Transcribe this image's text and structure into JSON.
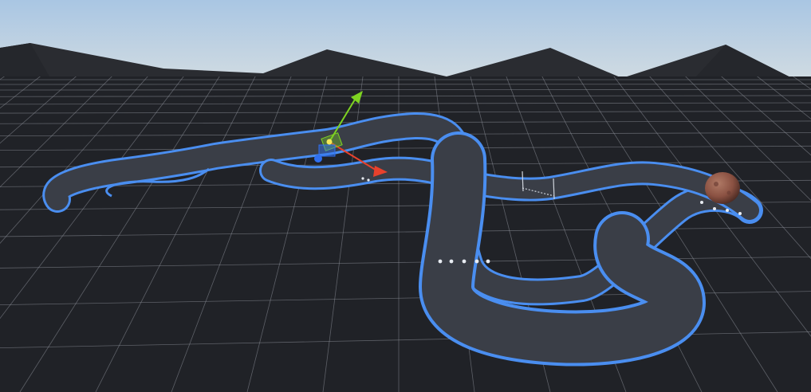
{
  "scene": {
    "view": "3d-scene-view",
    "colors": {
      "sky_top": "#a9c6e3",
      "sky_bottom": "#d4dde2",
      "mountain": "#2a2c31",
      "ground": "#202227",
      "grid_line": "#8f949c",
      "track_surface": "#3a3e47",
      "track_edge": "#4a8ef0",
      "gizmo_y": "#7ed321",
      "gizmo_x": "#e8412c",
      "gizmo_z": "#2f6ff0",
      "boulder": "#8a5142"
    },
    "objects": [
      {
        "name": "race-track",
        "kind": "track-spline"
      },
      {
        "name": "checkpoint-gate",
        "kind": "gate"
      },
      {
        "name": "boulder",
        "kind": "rock-sphere"
      },
      {
        "name": "transform-gizmo",
        "kind": "move-tool",
        "axes": [
          "x",
          "y",
          "z"
        ]
      }
    ]
  }
}
